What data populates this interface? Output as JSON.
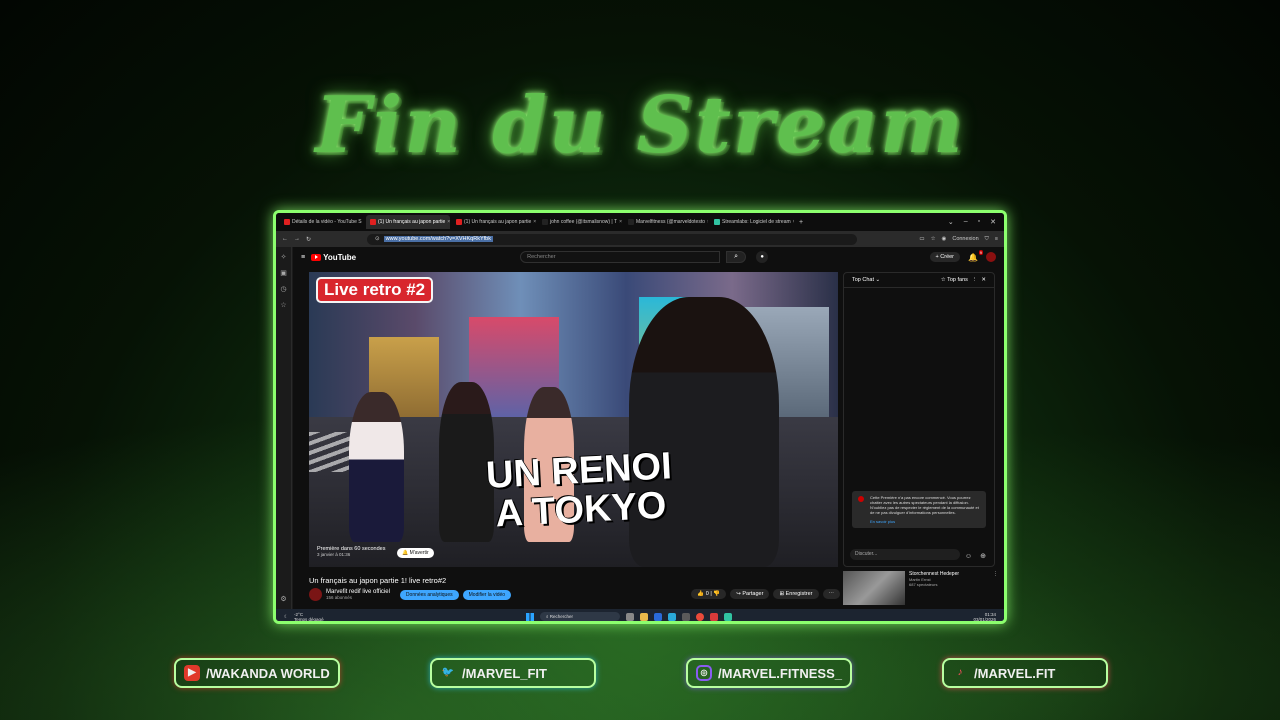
{
  "overlay": {
    "title": "Fin du Stream",
    "socials": [
      {
        "label": "/WAKANDA WORLD",
        "icon": "youtube-icon",
        "color": "#e0392b"
      },
      {
        "label": "/MARVEL_FIT",
        "icon": "twitter-icon",
        "color": "#2ec4e8"
      },
      {
        "label": "/MARVEL.FITNESS_",
        "icon": "instagram-icon",
        "color": "#8a5cf0"
      },
      {
        "label": "/MARVEL.FIT",
        "icon": "tiktok-icon",
        "color": "#ff4d5e"
      }
    ]
  },
  "browser": {
    "tabs": [
      {
        "label": "Détails de la vidéo - YouTube S"
      },
      {
        "label": "(1) Un français au japon partie"
      },
      {
        "label": "(1) Un français au japon partie"
      },
      {
        "label": "john coffee (@itsmalisnow) | T"
      },
      {
        "label": "Marvelfitness (@marveldotesto"
      },
      {
        "label": "Streamlabs: Logiciel de stream"
      }
    ],
    "url": "www.youtube.com/watch?v=XVHKqRkYfbk",
    "connexion": "Connexion"
  },
  "youtube": {
    "search_placeholder": "Rechercher",
    "create_label": "Créer",
    "notif_count": "9",
    "thumbnail": {
      "badge": "Live retro #2",
      "headline_line1": "UN RENOI",
      "headline_line2": "A TOKYO"
    },
    "premiere": {
      "label": "Première dans 60 secondes",
      "date": "3 janvier à 01:36",
      "remind": "M'avertir"
    },
    "video_title": "Un français au japon partie 1! live retro#2",
    "channel": {
      "name": "Marvefit redif live officiel",
      "subs": "156 abonnés",
      "analytics": "Données analytiques",
      "edit": "Modifier la vidéo"
    },
    "actions": {
      "likes": "0",
      "share": "Partager",
      "save": "Enregistrer"
    },
    "chat": {
      "mode": "Top Chat",
      "top_fans": "Top fans",
      "notice": "Cette Première n'a pas encore commencé. Vous pourrez chatter avec les autres spectateurs pendant la diffusion. N'oubliez pas de respecter le règlement de la communauté et de ne pas divulguer d'informations personnelles.",
      "learn_more": "En savoir plus",
      "input_placeholder": "Discuter..."
    },
    "recommendation": {
      "title": "Storchennest Hedeper",
      "channel": "Martin Ernst",
      "viewers": "687 spectateurs"
    }
  },
  "taskbar": {
    "temp": "-2°C",
    "weather": "Temps dégagé",
    "search": "Rechercher",
    "time": "01:34",
    "date": "03/01/2026"
  }
}
